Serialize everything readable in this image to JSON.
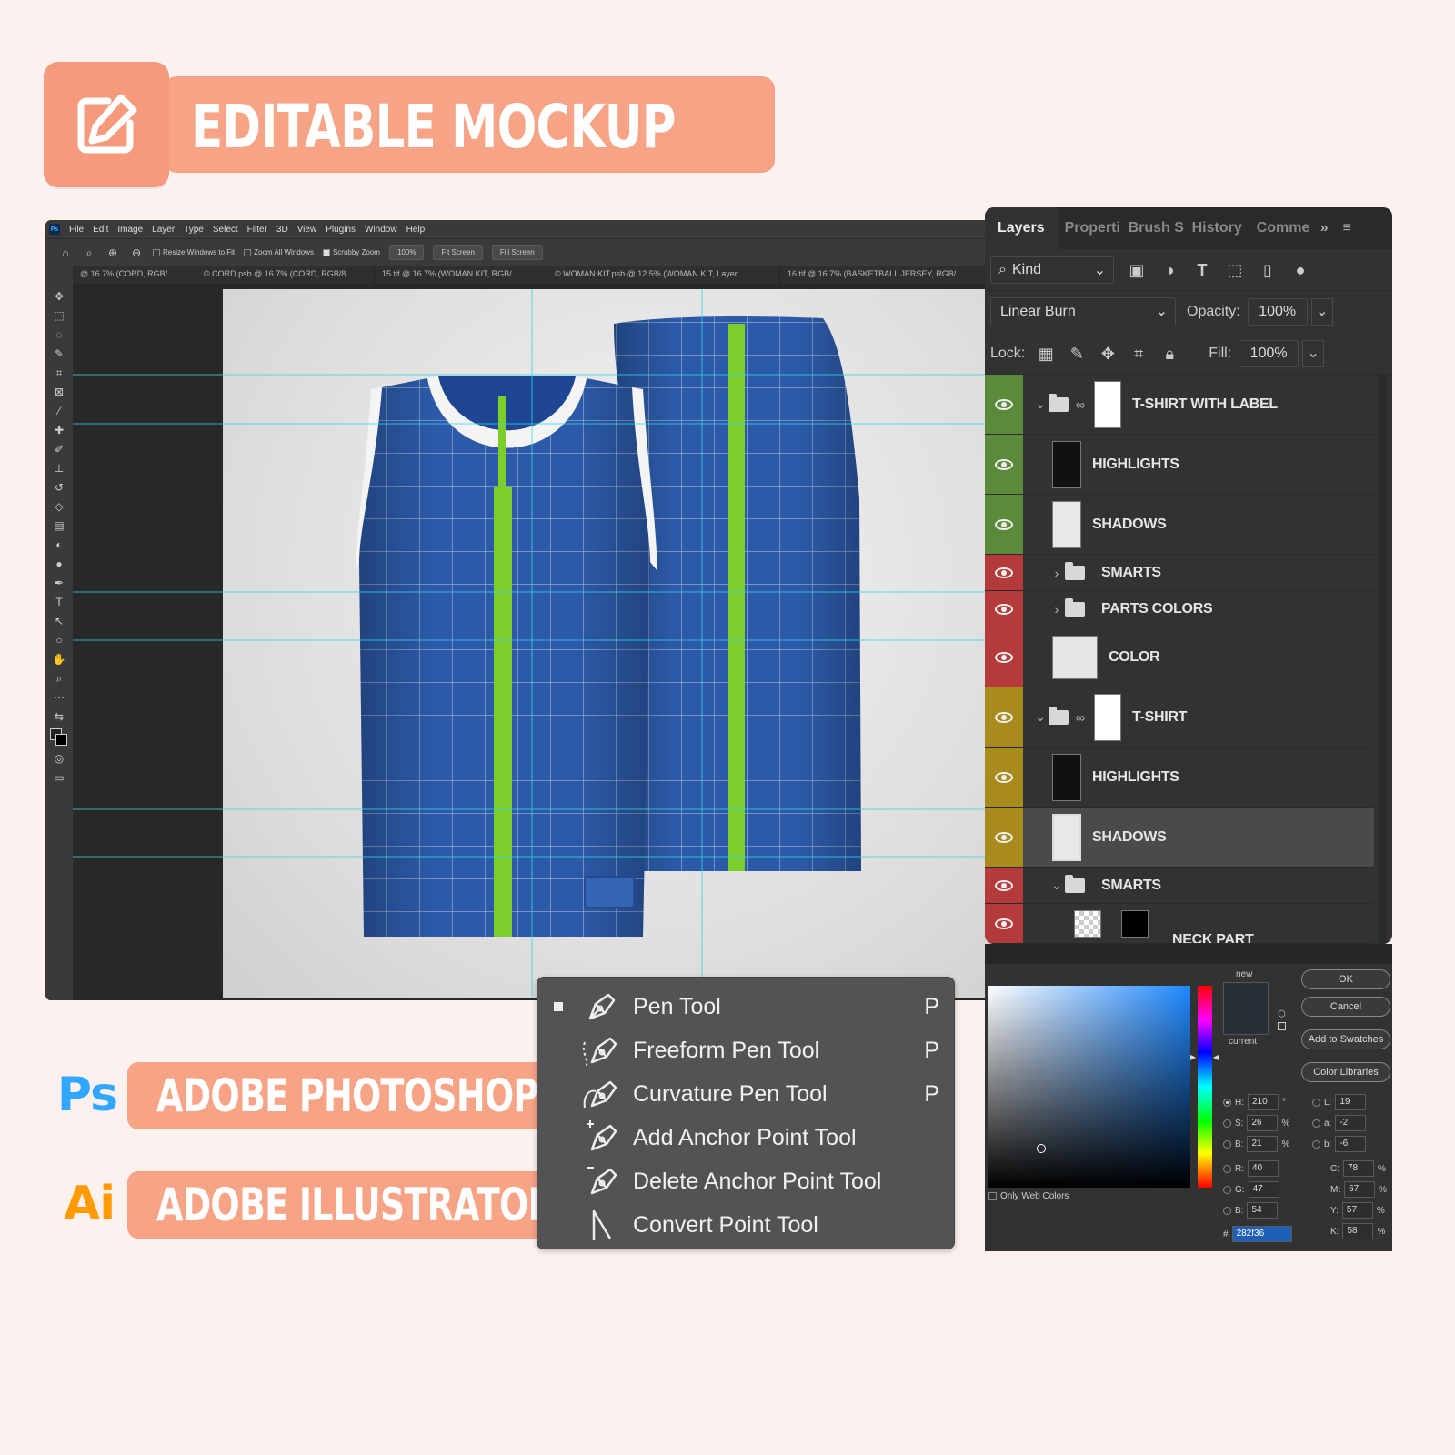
{
  "title_banner": {
    "text": "EDITABLE MOCKUP",
    "icon": "edit-icon"
  },
  "apps": [
    {
      "logo": "Ps",
      "name": "ADOBE PHOTOSHOP",
      "logo_bg": "#001e36",
      "logo_fg": "#31a8ff"
    },
    {
      "logo": "Ai",
      "name": "ADOBE ILLUSTRATOR",
      "logo_bg": "#330000",
      "logo_fg": "#ff9a00"
    }
  ],
  "colors": {
    "accent": "#f7a386",
    "ps_dark": "#282828",
    "jersey_blue": "#2c5aa8",
    "stripe_green": "#7ccf2a"
  },
  "menubar": {
    "items": [
      "File",
      "Edit",
      "Image",
      "Layer",
      "Type",
      "Select",
      "Filter",
      "3D",
      "View",
      "Plugins",
      "Window",
      "Help"
    ]
  },
  "options": {
    "resize_windows": "Resize Windows to Fit",
    "zoom_all": "Zoom All Windows",
    "scrubby_zoom": "Scrubby Zoom",
    "zoom_value": "100%",
    "fit_screen": "Fit Screen",
    "fill_screen": "Fill Screen"
  },
  "doc_tabs": [
    "@ 16.7% (CORD, RGB/...",
    "© CORD.psb @ 16.7% (CORD, RGB/8...",
    "15.tif @ 16.7% (WOMAN KIT, RGB/...",
    "© WOMAN KIT.psb @ 12.5% (WOMAN KIT, Layer...",
    "16.tif @ 16.7% (BASKETBALL JERSEY, RGB/..."
  ],
  "layers_panel": {
    "tabs": [
      "Layers",
      "Properti",
      "Brush S",
      "History",
      "Comme"
    ],
    "kind": "Kind",
    "blend_mode": "Linear Burn",
    "opacity_label": "Opacity:",
    "opacity": "100%",
    "lock_label": "Lock:",
    "fill_label": "Fill:",
    "fill": "100%",
    "layers": [
      {
        "name": "T-SHIRT WITH LABEL",
        "type": "group",
        "expanded": true,
        "color": "#5b8a3a"
      },
      {
        "name": "HIGHLIGHTS",
        "type": "layer",
        "color": "#5b8a3a"
      },
      {
        "name": "SHADOWS",
        "type": "layer",
        "color": "#5b8a3a"
      },
      {
        "name": "SMARTS",
        "type": "folder",
        "expanded": false,
        "color": "#b53a3a"
      },
      {
        "name": "PARTS COLORS",
        "type": "folder",
        "expanded": false,
        "color": "#b53a3a"
      },
      {
        "name": "COLOR",
        "type": "layer",
        "color": "#b53a3a"
      },
      {
        "name": "T-SHIRT",
        "type": "group",
        "expanded": true,
        "color": "#a88a1e"
      },
      {
        "name": "HIGHLIGHTS",
        "type": "layer",
        "color": "#a88a1e"
      },
      {
        "name": "SHADOWS",
        "type": "layer",
        "color": "#a88a1e",
        "selected": true
      },
      {
        "name": "SMARTS",
        "type": "folder",
        "expanded": true,
        "color": "#b53a3a"
      },
      {
        "name": "NECK PART",
        "type": "layer",
        "color": "#b53a3a"
      }
    ]
  },
  "tool_menu": {
    "items": [
      {
        "label": "Pen Tool",
        "key": "P",
        "active": true
      },
      {
        "label": "Freeform Pen Tool",
        "key": "P"
      },
      {
        "label": "Curvature Pen Tool",
        "key": "P"
      },
      {
        "label": "Add Anchor Point Tool",
        "key": ""
      },
      {
        "label": "Delete Anchor Point Tool",
        "key": ""
      },
      {
        "label": "Convert Point Tool",
        "key": ""
      }
    ]
  },
  "color_picker": {
    "new_label": "new",
    "current_label": "current",
    "ok": "OK",
    "cancel": "Cancel",
    "add_swatches": "Add to Swatches",
    "color_libraries": "Color Libraries",
    "only_web": "Only Web Colors",
    "H": "210",
    "S": "26",
    "Bv": "21",
    "R": "40",
    "G": "47",
    "Bc": "54",
    "L": "19",
    "a": "-2",
    "b": "-6",
    "C": "78",
    "M": "67",
    "Y": "57",
    "K": "58",
    "hex": "282f36",
    "deg": "°",
    "pct": "%",
    "hash": "#"
  }
}
